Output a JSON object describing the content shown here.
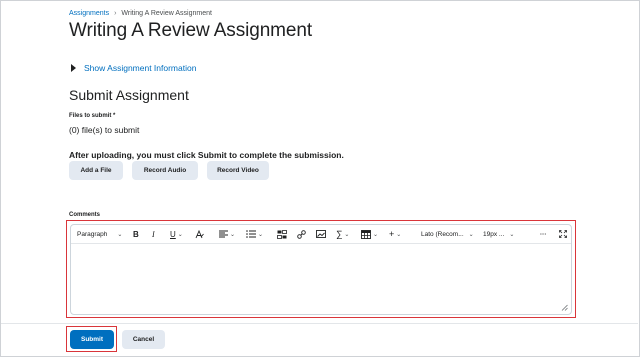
{
  "breadcrumb": {
    "parent": "Assignments",
    "separator": "›",
    "current": "Writing A Review Assignment"
  },
  "page_title": "Writing A Review Assignment",
  "show_info": {
    "label": "Show Assignment Information",
    "icon": "triangle-right-icon"
  },
  "submit_section": {
    "title": "Submit Assignment",
    "files_label": "Files to submit *",
    "files_count": "(0) file(s) to submit",
    "instruction": "After uploading, you must click Submit to complete the submission.",
    "buttons": {
      "add_file": "Add a File",
      "record_audio": "Record Audio",
      "record_video": "Record Video"
    }
  },
  "comments": {
    "label": "Comments",
    "toolbar": {
      "format": "Paragraph",
      "font_family": "Lato (Recom...",
      "font_size": "19px ...",
      "bold": "B",
      "italic": "I",
      "underline": "U",
      "more": "···"
    },
    "value": ""
  },
  "footer": {
    "submit_label": "Submit",
    "cancel_label": "Cancel"
  },
  "colors": {
    "accent": "#006fbf",
    "highlight": "#d9353a",
    "secondary_button": "#e3e9f1"
  }
}
